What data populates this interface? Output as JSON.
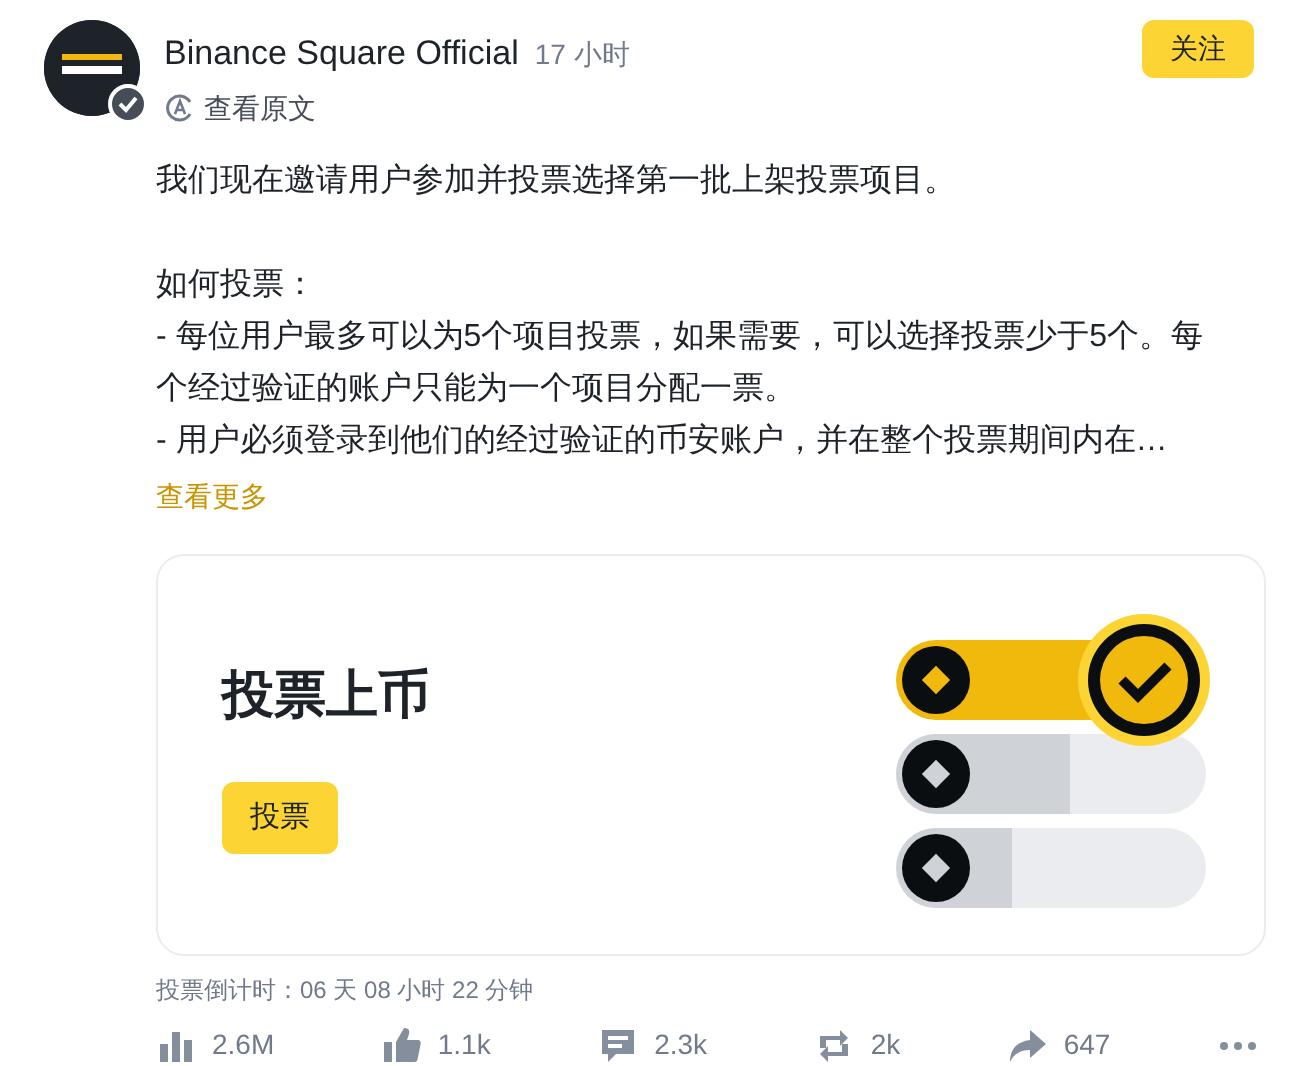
{
  "post": {
    "author": "Binance Square Official",
    "time": "17 小时",
    "verified": true,
    "follow_button": "关注",
    "translate_link": "查看原文",
    "intro": "我们现在邀请用户参加并投票选择第一批上架投票项目。",
    "how_to_vote": [
      "如何投票：",
      "- 每位用户最多可以为5个项目投票，如果需要，可以选择投票少于5个。每个经过验证的账户只能为一个项目分配一票。",
      "- 用户必须登录到他们的经过验证的币安账户，并在整个投票期间内在…"
    ],
    "see_more": "查看更多"
  },
  "card": {
    "title": "投票上币",
    "button": "投票"
  },
  "countdown": "投票倒计时：06 天 08 小时 22 分钟",
  "stats": [
    {
      "kind": "views",
      "value": "2.6M"
    },
    {
      "kind": "likes",
      "value": "1.1k"
    },
    {
      "kind": "comments",
      "value": "2.3k"
    },
    {
      "kind": "reposts",
      "value": "2k"
    },
    {
      "kind": "shares",
      "value": "647"
    },
    {
      "kind": "more"
    }
  ]
}
